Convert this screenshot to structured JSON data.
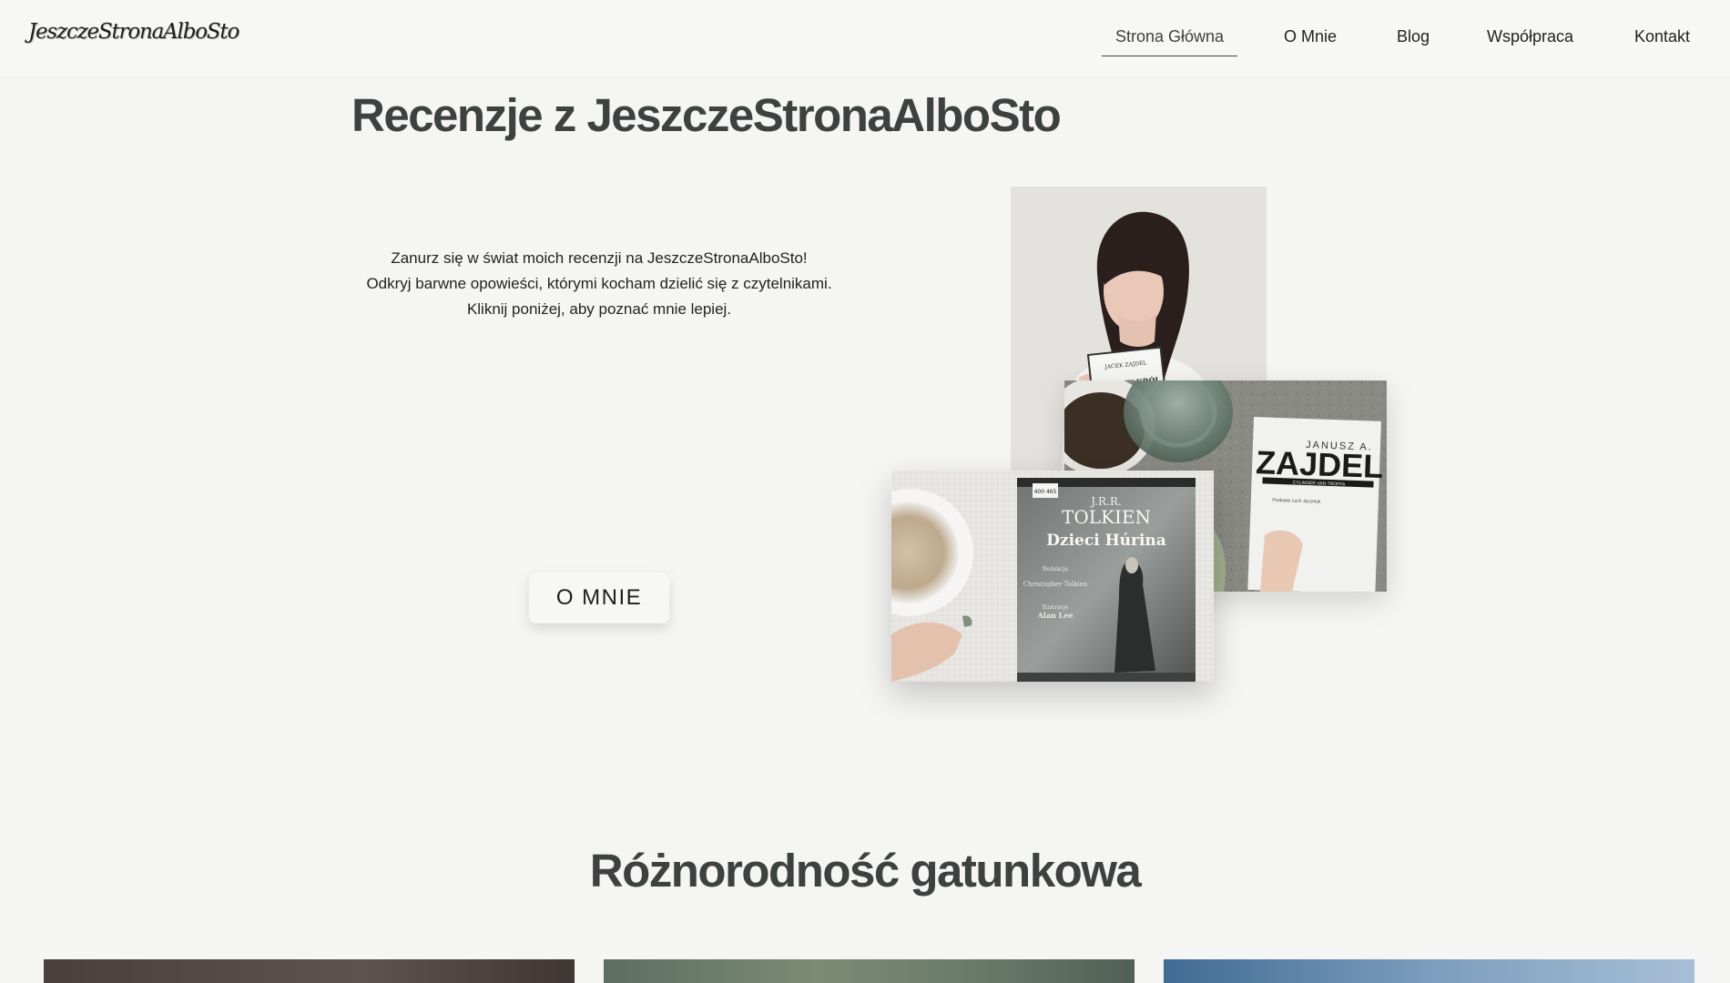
{
  "header": {
    "logo_text": "JeszczeStronaAlboSto",
    "nav": [
      {
        "label": "Strona Główna",
        "active": true
      },
      {
        "label": "O Mnie",
        "active": false
      },
      {
        "label": "Blog",
        "active": false
      },
      {
        "label": "Współpraca",
        "active": false
      },
      {
        "label": "Kontakt",
        "active": false
      }
    ]
  },
  "hero": {
    "title": "Recenzje z JeszczeStronaAlboSto",
    "lines": [
      "Zanurz się w świat moich recenzji na JeszczeStronaAlboSto!",
      "Odkryj barwne opowieści, którymi kocham dzielić się z czytelnikami.",
      "Kliknij poniżej, aby poznać mnie lepiej."
    ],
    "button_label": "O MNIE"
  },
  "collage": {
    "portrait_book": {
      "author": "JACEK ZAJDEL",
      "title": "ŻELAZNY KRÓL"
    },
    "zajdel_book": {
      "author": "JANUSZ A.",
      "title": "ZAJDEL",
      "subtitle": "CYLINDER VAN TROFFA",
      "note": "Posłowie Lech Jęczmyk"
    },
    "tolkien_book": {
      "sticker": "400 465",
      "author_initials": "J.R.R.",
      "author": "TOLKIEN",
      "title": "Dzieci Húrina",
      "editor_label": "Redakcja",
      "editor_name": "Christopher Tolkien",
      "illustrator_label": "Ilustracje",
      "illustrator_name": "Alan Lee"
    }
  },
  "genres": {
    "title": "Różnorodność gatunkowa"
  },
  "colors": {
    "heading": "#3d4140",
    "background": "#f5f5f4",
    "header_bg": "#f7f7f6",
    "text": "#1f2120"
  }
}
